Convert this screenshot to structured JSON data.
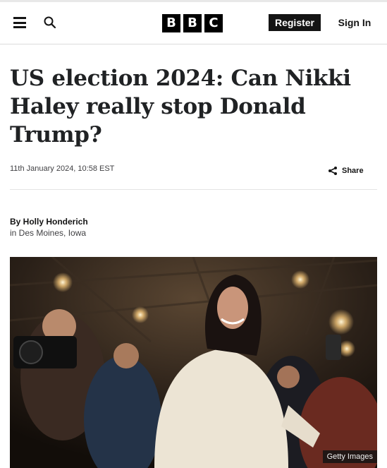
{
  "header": {
    "logo_letters": [
      "B",
      "B",
      "C"
    ],
    "register_label": "Register",
    "signin_label": "Sign In",
    "icons": {
      "menu": "hamburger-menu-icon",
      "search": "search-icon"
    }
  },
  "article": {
    "headline": "US election 2024: Can Nikki Haley really stop Donald Trump?",
    "timestamp": "11th January 2024, 10:58 EST",
    "share_label": "Share",
    "byline": {
      "name": "By Holly Honderich",
      "location": "in Des Moines, Iowa"
    },
    "image": {
      "credit": "Getty Images"
    }
  }
}
